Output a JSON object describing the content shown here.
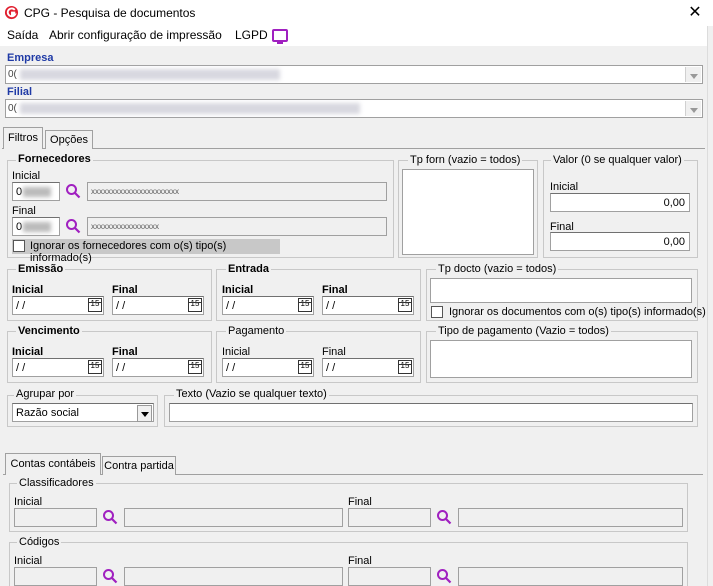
{
  "window": {
    "title": "CPG - Pesquisa de documentos"
  },
  "menu": {
    "items": [
      "Saída",
      "Abrir configuração de impressão",
      "LGPD"
    ]
  },
  "empresa": {
    "label": "Empresa",
    "prefix": "0("
  },
  "filial": {
    "label": "Filial",
    "prefix": "0("
  },
  "tabs_top": [
    "Filtros",
    "Opções"
  ],
  "fornecedores": {
    "title": "Fornecedores",
    "inicial_label": "Inicial",
    "inicial_code": "0",
    "inicial_name": "xxxxxxxxxxxxxxxxxxxxxx",
    "final_label": "Final",
    "final_code": "0",
    "final_name": "xxxxxxxxxxxxxxxxx",
    "ignore_label": "Ignorar os fornecedores com o(s) tipo(s) informado(s)"
  },
  "tp_forn": {
    "title": "Tp forn (vazio = todos)"
  },
  "valor": {
    "title": "Valor (0 se qualquer valor)",
    "inicial_label": "Inicial",
    "inicial_value": "0,00",
    "final_label": "Final",
    "final_value": "0,00"
  },
  "emissao": {
    "title": "Emissão",
    "inicial_label": "Inicial",
    "final_label": "Final",
    "inicial_value": " / /",
    "final_value": " / /"
  },
  "entrada": {
    "title": "Entrada",
    "inicial_label": "Inicial",
    "final_label": "Final",
    "inicial_value": " / /",
    "final_value": " / /"
  },
  "tp_docto": {
    "title": "Tp docto (vazio = todos)",
    "ignore_label": "Ignorar os documentos com o(s) tipo(s) informado(s)"
  },
  "vencimento": {
    "title": "Vencimento",
    "inicial_label": "Inicial",
    "final_label": "Final",
    "inicial_value": " / /",
    "final_value": " / /"
  },
  "pagamento": {
    "title": "Pagamento",
    "inicial_label": "Inicial",
    "final_label": "Final",
    "inicial_value": " / /",
    "final_value": " / /"
  },
  "tipo_pagamento": {
    "title": "Tipo de pagamento (Vazio = todos)"
  },
  "agrupar": {
    "title": "Agrupar por",
    "selected": "Razão social"
  },
  "texto": {
    "title": "Texto (Vazio se qualquer texto)"
  },
  "calendar_glyph": "15",
  "tabs_bottom": [
    "Contas contábeis",
    "Contra partida"
  ],
  "classificadores": {
    "title": "Classificadores",
    "inicial_label": "Inicial",
    "final_label": "Final"
  },
  "codigos": {
    "title": "Códigos",
    "inicial_label": "Inicial",
    "final_label": "Final"
  },
  "colors": {
    "accent": "#a020c0",
    "label_blue": "#1f3aa6",
    "window_bg": "#f0f0f0"
  }
}
